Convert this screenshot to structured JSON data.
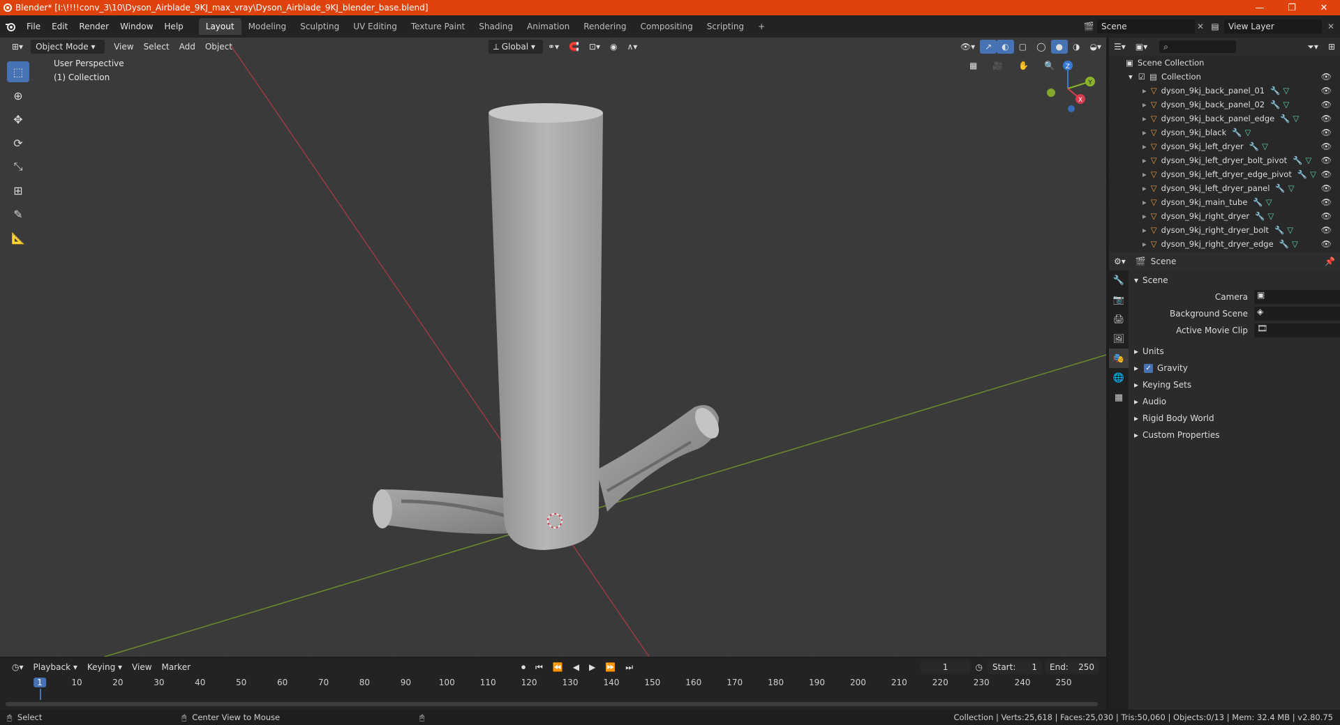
{
  "window": {
    "title": "Blender* [I:\\!!!!conv_3\\10\\Dyson_Airblade_9KJ_max_vray\\Dyson_Airblade_9KJ_blender_base.blend]"
  },
  "menu": [
    "File",
    "Edit",
    "Render",
    "Window",
    "Help"
  ],
  "workspaces": [
    "Layout",
    "Modeling",
    "Sculpting",
    "UV Editing",
    "Texture Paint",
    "Shading",
    "Animation",
    "Rendering",
    "Compositing",
    "Scripting"
  ],
  "active_workspace": "Layout",
  "scene_name": "Scene",
  "view_layer": "View Layer",
  "viewport": {
    "mode": "Object Mode",
    "menus": [
      "View",
      "Select",
      "Add",
      "Object"
    ],
    "transform_orientation": "Global",
    "info_line1": "User Perspective",
    "info_line2": "(1) Collection",
    "gizmo_labels": {
      "z": "Z",
      "y": "Y",
      "x": "X"
    }
  },
  "outliner": {
    "root": "Scene Collection",
    "collection": "Collection",
    "objects": [
      "dyson_9kj_back_panel_01",
      "dyson_9kj_back_panel_02",
      "dyson_9kj_back_panel_edge",
      "dyson_9kj_black",
      "dyson_9kj_left_dryer",
      "dyson_9kj_left_dryer_bolt_pivot",
      "dyson_9kj_left_dryer_edge_pivot",
      "dyson_9kj_left_dryer_panel",
      "dyson_9kj_main_tube",
      "dyson_9kj_right_dryer",
      "dyson_9kj_right_dryer_bolt",
      "dyson_9kj_right_dryer_edge"
    ]
  },
  "properties": {
    "header": "Scene",
    "panel": "Scene",
    "fields": [
      {
        "label": "Camera"
      },
      {
        "label": "Background Scene"
      },
      {
        "label": "Active Movie Clip"
      }
    ],
    "sections": [
      "Units",
      "Gravity",
      "Keying Sets",
      "Audio",
      "Rigid Body World",
      "Custom Properties"
    ],
    "gravity_checked": true
  },
  "timeline": {
    "menus": [
      "Playback",
      "Keying",
      "View",
      "Marker"
    ],
    "current_frame": "1",
    "start_label": "Start:",
    "start": "1",
    "end_label": "End:",
    "end": "250",
    "frame_marks": [
      "1",
      "10",
      "20",
      "30",
      "40",
      "50",
      "60",
      "70",
      "80",
      "90",
      "100",
      "110",
      "120",
      "130",
      "140",
      "150",
      "160",
      "170",
      "180",
      "190",
      "200",
      "210",
      "220",
      "230",
      "240",
      "250"
    ]
  },
  "status": {
    "left1": "Select",
    "left2": "Center View to Mouse",
    "right": "Collection | Verts:25,618 | Faces:25,030 | Tris:50,060 | Objects:0/13 | Mem: 32.4 MB | v2.80.75"
  },
  "colors": {
    "titlebar": "#e0420e",
    "accent": "#4772b3",
    "object_icon": "#e89b3b",
    "x_axis": "#d63c4e",
    "y_axis": "#8bb42a",
    "z_axis": "#3a78d6"
  }
}
